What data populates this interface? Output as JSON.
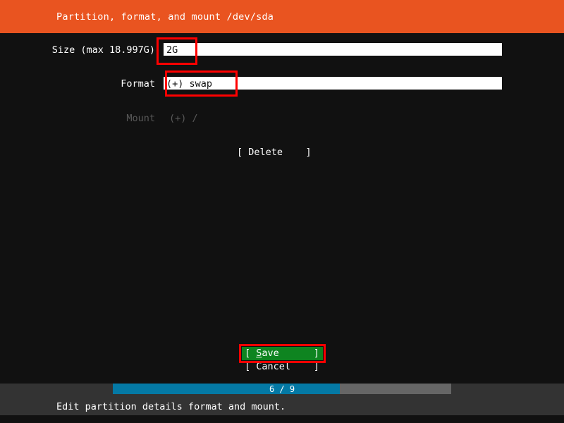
{
  "header": {
    "title": "Partition, format, and mount /dev/sda",
    "background": "#e95420"
  },
  "form": {
    "size": {
      "label": "Size (max 18.997G)",
      "value": "2G",
      "focused": true
    },
    "format": {
      "label": "Format",
      "value": "(+) swap",
      "focused": true
    },
    "mount": {
      "label": "Mount",
      "value": "(+) /",
      "disabled": true
    }
  },
  "actions": {
    "delete": "[ Delete    ]",
    "save_open": "[ ",
    "save_accel": "S",
    "save_rest": "ave",
    "save_close": "]",
    "cancel": "[ Cancel",
    "cancel_close": "]"
  },
  "footer": {
    "progress": {
      "label": "6 / 9",
      "current": 6,
      "total": 9,
      "percent": 67,
      "fill_color": "#0479a5",
      "track_color": "#666666"
    },
    "status": "Edit partition details format and mount."
  },
  "highlight": {
    "color": "#ff0000"
  }
}
